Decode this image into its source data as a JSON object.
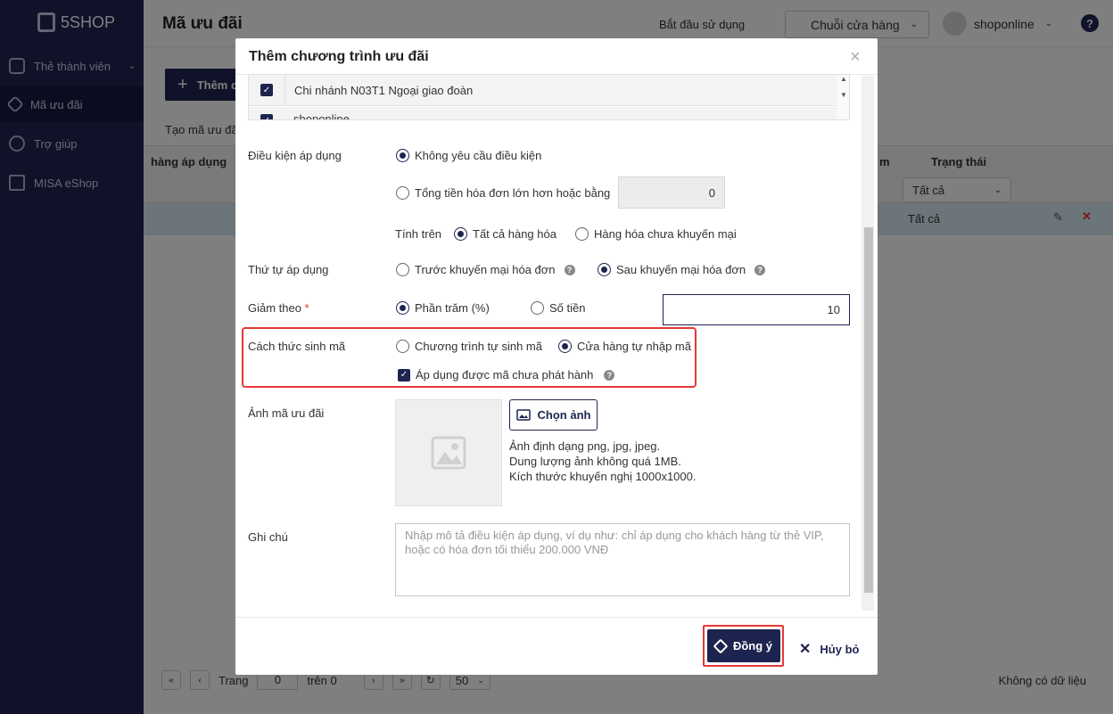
{
  "app": {
    "brand": "5SHOP"
  },
  "sidebar": {
    "items": [
      {
        "label": "Thẻ thành viên"
      },
      {
        "label": "Mã ưu đãi"
      },
      {
        "label": "Trợ giúp"
      },
      {
        "label": "MISA eShop"
      }
    ]
  },
  "header": {
    "page_title": "Mã ưu đãi",
    "start_link": "Bắt đầu sử dụng",
    "store_select": "Chuỗi cửa hàng",
    "user": "shoponline"
  },
  "page": {
    "add_button": "Thêm c",
    "subtitle": "Tạo mã ưu đã",
    "col_apply": "hàng áp dụng",
    "col_m": "m",
    "col_status": "Trạng thái",
    "status_filter": "Tất cả",
    "row_status": "Tất cả",
    "pager_label": "Trang",
    "pager_value": "0",
    "pager_of": "trên 0",
    "page_size": "50",
    "no_data": "Không có dữ liệu"
  },
  "modal": {
    "title": "Thêm chương trình ưu đãi",
    "branches": [
      "Chi nhánh N03T1 Ngoại giao đoàn",
      "shoponline"
    ],
    "condition": {
      "label": "Điều kiện áp dụng",
      "opt_none": "Không yêu cầu điều kiện",
      "opt_total": "Tổng tiền hóa đơn lớn hơn hoặc bằng",
      "total_value": "0",
      "calc_label": "Tính trên",
      "calc_all": "Tất cả hàng hóa",
      "calc_nonpromo": "Hàng hóa chưa khuyến mại"
    },
    "order": {
      "label": "Thứ tự áp dụng",
      "before": "Trước khuyến mại hóa đơn",
      "after": "Sau khuyến mại hóa đơn"
    },
    "discount": {
      "label": "Giảm theo",
      "required_mark": "*",
      "percent": "Phần trăm (%)",
      "amount": "Số tiền",
      "value": "10"
    },
    "gen": {
      "label": "Cách thức sinh mã",
      "auto": "Chương trình tự sinh mã",
      "manual": "Cửa hàng tự nhập mã",
      "unissued": "Áp dụng được mã chưa phát hành"
    },
    "image": {
      "label": "Ảnh mã ưu đãi",
      "choose": "Chọn ảnh",
      "hint1": "Ảnh định dạng png, jpg, jpeg.",
      "hint2": "Dung lượng ảnh không quá 1MB.",
      "hint3": "Kích thước khuyến nghị 1000x1000."
    },
    "note": {
      "label": "Ghi chú",
      "placeholder": "Nhập mô tả điều kiện áp dụng, ví dụ như: chỉ áp dụng cho khách hàng từ thẻ VIP, hoặc có hóa đơn tối thiểu 200.000 VNĐ"
    },
    "ok": "Đồng ý",
    "cancel": "Hủy bỏ"
  },
  "colors": {
    "primary": "#1e2450",
    "highlight": "#e53935",
    "required": "#e53935"
  }
}
